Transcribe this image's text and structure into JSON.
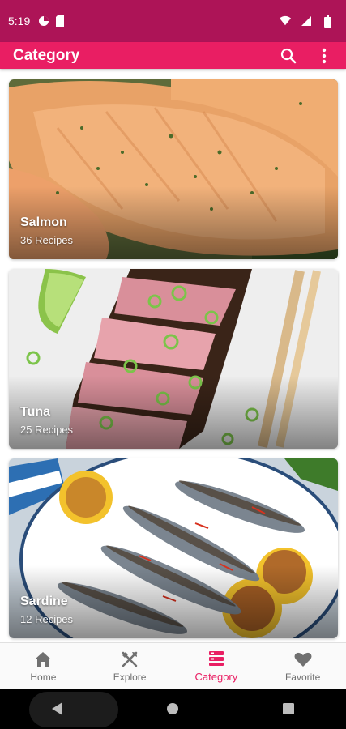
{
  "status_bar": {
    "time": "5:19",
    "icons": [
      "data-saver-icon",
      "sim-card-icon",
      "wifi-icon",
      "signal-icon",
      "battery-icon"
    ]
  },
  "app_bar": {
    "title": "Category",
    "actions": [
      "search-icon",
      "more-vert-icon"
    ]
  },
  "categories": [
    {
      "name": "Salmon",
      "count": "36 Recipes",
      "image": "salmon-photo"
    },
    {
      "name": "Tuna",
      "count": "25 Recipes",
      "image": "tuna-photo"
    },
    {
      "name": "Sardine",
      "count": "12 Recipes",
      "image": "sardine-photo"
    }
  ],
  "bottom_nav": {
    "active": "Category",
    "items": [
      {
        "label": "Home",
        "icon": "home-icon"
      },
      {
        "label": "Explore",
        "icon": "fork-knife-icon"
      },
      {
        "label": "Category",
        "icon": "category-icon"
      },
      {
        "label": "Favorite",
        "icon": "heart-icon"
      }
    ]
  },
  "colors": {
    "status_bar": "#ad1457",
    "primary": "#e91e63",
    "inactive": "#707070",
    "nav_background": "#fafafa",
    "system_nav": "#000000"
  },
  "system_nav": [
    "back-icon",
    "home-circle-icon",
    "recents-icon"
  ]
}
